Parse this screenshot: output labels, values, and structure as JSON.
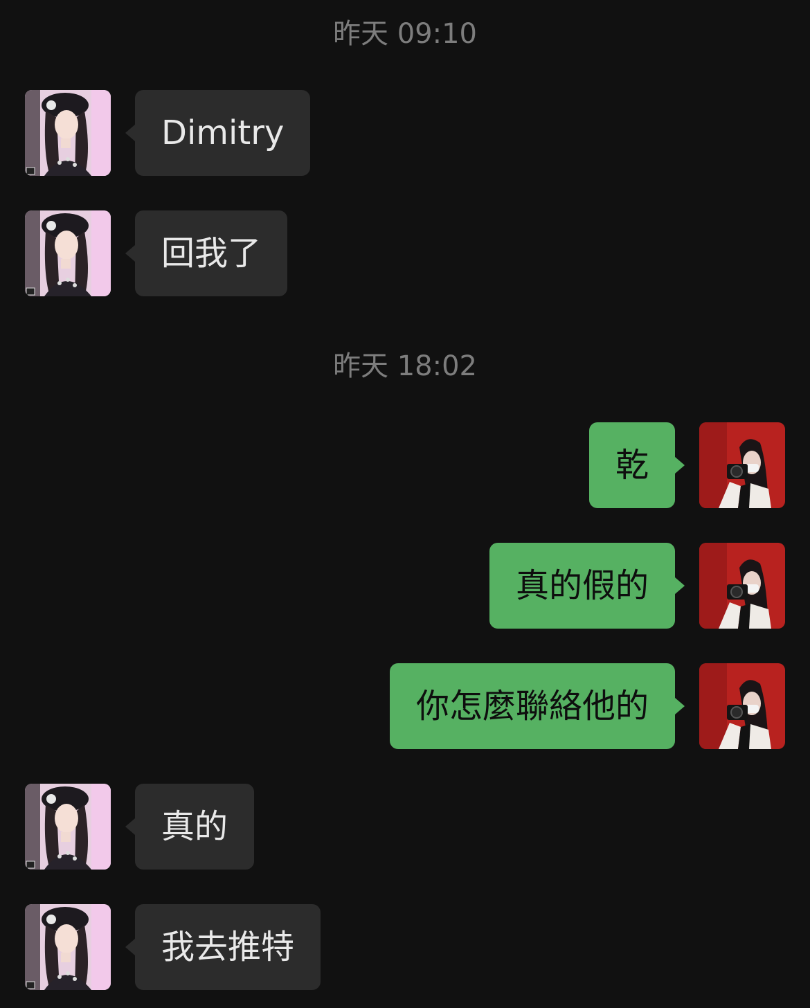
{
  "chat": {
    "timestamps": [
      "昨天 09:10",
      "昨天 18:02"
    ],
    "messages": [
      {
        "side": "left",
        "text": "Dimitry"
      },
      {
        "side": "left",
        "text": "回我了"
      },
      {
        "side": "right",
        "text": "乾"
      },
      {
        "side": "right",
        "text": "真的假的"
      },
      {
        "side": "right",
        "text": "你怎麼聯絡他的"
      },
      {
        "side": "left",
        "text": "真的"
      },
      {
        "side": "left",
        "text": "我去推特"
      }
    ],
    "contact_avatar_icon": "contact-avatar-photo",
    "self_avatar_icon": "self-avatar-photo",
    "colors": {
      "background": "#111111",
      "incoming_bubble": "#2c2c2c",
      "outgoing_bubble": "#56b162",
      "timestamp_text": "#7d7d7d"
    }
  }
}
